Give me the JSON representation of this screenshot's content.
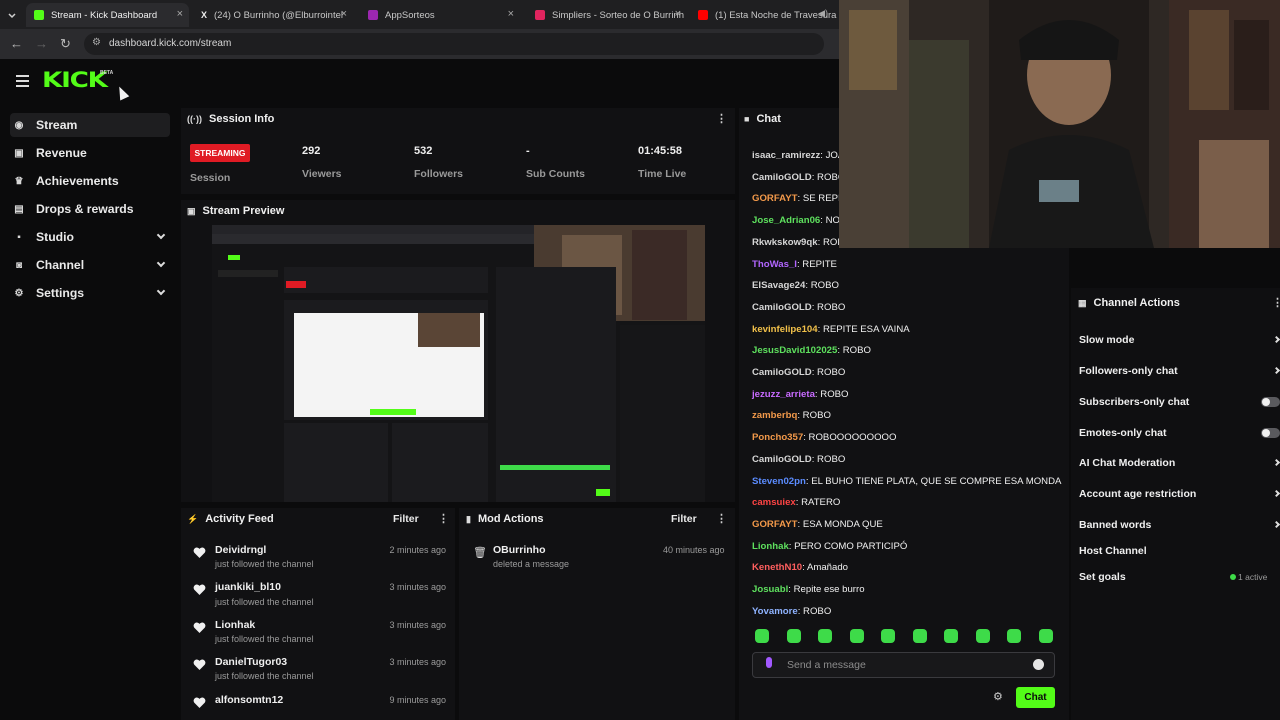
{
  "browser": {
    "tabs": [
      {
        "title": "Stream - Kick Dashboard",
        "fav": "#53fc18"
      },
      {
        "title": "(24) O Burrinho (@Elburrointel",
        "fav": "#1f1f21"
      },
      {
        "title": "AppSorteos",
        "fav": "#9c27b0"
      },
      {
        "title": "Simpliers - Sorteo de O Burrinh",
        "fav": "#e0245e"
      },
      {
        "title": "(1) Esta Noche de Travesura",
        "fav": "#ff0000"
      }
    ],
    "url": "dashboard.kick.com/stream"
  },
  "brand": {
    "logo": "KICK",
    "beta": "BETA",
    "accent": "#53fc18"
  },
  "sidebar": {
    "items": [
      {
        "label": "Stream",
        "icon": "stream-icon"
      },
      {
        "label": "Revenue",
        "icon": "revenue-icon"
      },
      {
        "label": "Achievements",
        "icon": "trophy-icon"
      },
      {
        "label": "Drops & rewards",
        "icon": "drops-icon"
      },
      {
        "label": "Studio",
        "icon": "studio-icon"
      },
      {
        "label": "Channel",
        "icon": "channel-icon"
      },
      {
        "label": "Settings",
        "icon": "gear-icon"
      }
    ]
  },
  "session": {
    "title": "Session Info",
    "badge": "STREAMING",
    "badge_label": "Session",
    "stats": [
      {
        "value": "292",
        "label": "Viewers"
      },
      {
        "value": "532",
        "label": "Followers"
      },
      {
        "value": "-",
        "label": "Sub Counts"
      },
      {
        "value": "01:45:58",
        "label": "Time Live"
      }
    ]
  },
  "preview": {
    "title": "Stream Preview"
  },
  "activity": {
    "title": "Activity Feed",
    "filter": "Filter",
    "items": [
      {
        "name": "Deividrngl",
        "sub": "just followed the channel",
        "time": "2 minutes ago"
      },
      {
        "name": "juankiki_bl10",
        "sub": "just followed the channel",
        "time": "3 minutes ago"
      },
      {
        "name": "Lionhak",
        "sub": "just followed the channel",
        "time": "3 minutes ago"
      },
      {
        "name": "DanielTugor03",
        "sub": "just followed the channel",
        "time": "3 minutes ago"
      },
      {
        "name": "alfonsomtn12",
        "sub": "",
        "time": "9 minutes ago"
      }
    ]
  },
  "mod": {
    "title": "Mod Actions",
    "filter": "Filter",
    "items": [
      {
        "name": "OBurrinho",
        "sub": "deleted a message",
        "time": "40 minutes ago"
      }
    ]
  },
  "chat": {
    "title": "Chat",
    "messages": [
      {
        "user": "isaac_ramirezz",
        "color": "#d6d6d6",
        "text": "JOA"
      },
      {
        "user": "CamiloGOLD",
        "color": "#d6d6d6",
        "text": "ROBO"
      },
      {
        "user": "GORFAYT",
        "color": "#f2994a",
        "text": "SE REPIT"
      },
      {
        "user": "Jose_Adrian06",
        "color": "#5ee05e",
        "text": "NO"
      },
      {
        "user": "Rkwkskow9qk",
        "color": "#d6d6d6",
        "text": "ROB"
      },
      {
        "user": "ThoWas_I",
        "color": "#b266ff",
        "text": "REPITE"
      },
      {
        "user": "ElSavage24",
        "color": "#d6d6d6",
        "text": "ROBO"
      },
      {
        "user": "CamiloGOLD",
        "color": "#d6d6d6",
        "text": "ROBO"
      },
      {
        "user": "kevinfelipe104",
        "color": "#f2c14a",
        "text": "REPITE ESA VAINA"
      },
      {
        "user": "JesusDavid102025",
        "color": "#5ee05e",
        "text": "ROBO"
      },
      {
        "user": "CamiloGOLD",
        "color": "#d6d6d6",
        "text": "ROBO"
      },
      {
        "user": "jezuzz_arrieta",
        "color": "#c86bff",
        "text": "ROBO"
      },
      {
        "user": "zamberbq",
        "color": "#f2994a",
        "text": "ROBO"
      },
      {
        "user": "Poncho357",
        "color": "#f2994a",
        "text": "ROBOOOOOOOOO"
      },
      {
        "user": "CamiloGOLD",
        "color": "#d6d6d6",
        "text": "ROBO"
      },
      {
        "user": "Steven02pn",
        "color": "#5b8cff",
        "text": "EL BUHO TIENE PLATA, QUE SE COMPRE ESA MONDA"
      },
      {
        "user": "camsuiex",
        "color": "#ff4444",
        "text": "RATERO"
      },
      {
        "user": "GORFAYT",
        "color": "#f2994a",
        "text": "ESA MONDA QUE"
      },
      {
        "user": "Lionhak",
        "color": "#5ee05e",
        "text": "PERO COMO PARTICIPÓ"
      },
      {
        "user": "KenethN10",
        "color": "#ff5f5f",
        "text": "Amañado"
      },
      {
        "user": "Josuabl",
        "color": "#5ee05e",
        "text": "Repite ese burro"
      },
      {
        "user": "Yovamore",
        "color": "#8fb3ff",
        "text": "ROBO"
      }
    ],
    "placeholder": "Send a message",
    "send": "Chat"
  },
  "actions": {
    "title": "Channel Actions",
    "items": [
      {
        "label": "Slow mode",
        "control": "arrow"
      },
      {
        "label": "Followers-only chat",
        "control": "arrow"
      },
      {
        "label": "Subscribers-only chat",
        "control": "toggle"
      },
      {
        "label": "Emotes-only chat",
        "control": "toggle"
      },
      {
        "label": "AI Chat Moderation",
        "control": "arrow"
      },
      {
        "label": "Account age restriction",
        "control": "arrow"
      },
      {
        "label": "Banned words",
        "control": "arrow"
      },
      {
        "label": "Host Channel",
        "control": "none"
      },
      {
        "label": "Set goals",
        "control": "status",
        "status": "1 active"
      }
    ]
  }
}
